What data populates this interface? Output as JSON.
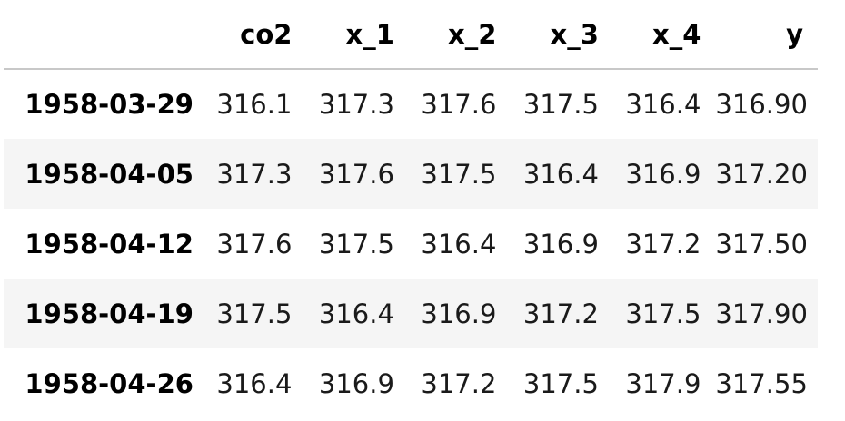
{
  "table": {
    "index_header": "",
    "columns": [
      "co2",
      "x_1",
      "x_2",
      "x_3",
      "x_4",
      "y"
    ],
    "rows": [
      {
        "index": "1958-03-29",
        "values": [
          "316.1",
          "317.3",
          "317.6",
          "317.5",
          "316.4",
          "316.90"
        ]
      },
      {
        "index": "1958-04-05",
        "values": [
          "317.3",
          "317.6",
          "317.5",
          "316.4",
          "316.9",
          "317.20"
        ]
      },
      {
        "index": "1958-04-12",
        "values": [
          "317.6",
          "317.5",
          "316.4",
          "316.9",
          "317.2",
          "317.50"
        ]
      },
      {
        "index": "1958-04-19",
        "values": [
          "317.5",
          "316.4",
          "316.9",
          "317.2",
          "317.5",
          "317.90"
        ]
      },
      {
        "index": "1958-04-26",
        "values": [
          "316.4",
          "316.9",
          "317.2",
          "317.5",
          "317.9",
          "317.55"
        ]
      }
    ]
  },
  "colors": {
    "header_border": "#c8c8c8",
    "striped_row": "#f5f5f5",
    "background": "#ffffff"
  }
}
